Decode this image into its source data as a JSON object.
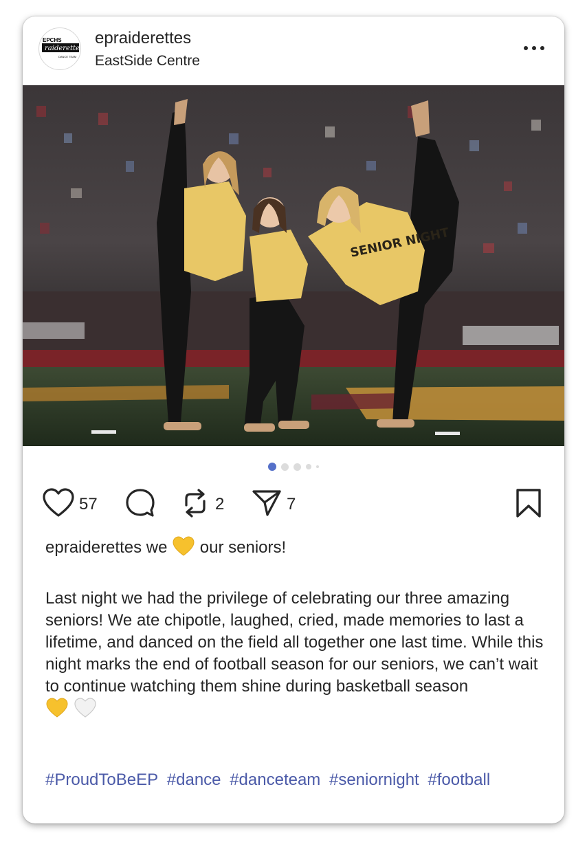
{
  "post": {
    "username": "epraiderettes",
    "location": "EastSide Centre",
    "avatar_text": {
      "top": "EPCHS",
      "middle": "raiderettes",
      "bottom": "DANCE TEAM"
    },
    "photo_shirt_text": "SENIOR NIGHT"
  },
  "carousel": {
    "count": 5,
    "active_index": 0
  },
  "actions": {
    "like_count": "57",
    "repost_count": "2",
    "share_count": "7"
  },
  "caption": {
    "username": "epraiderettes",
    "before_emoji": "we",
    "after_emoji": "our seniors!",
    "body": "Last night we had the privilege of celebrating our three amazing seniors! We ate chipotle, laughed, cried, made memories to last a lifetime, and danced on the field all together one last time. While this night marks the end of football season for our seniors, we can’t wait to continue watching them shine during basketball season",
    "hashtags": [
      "#ProudToBeEP",
      "#dance",
      "#danceteam",
      "#seniornight",
      "#football"
    ]
  },
  "colors": {
    "hashtag": "#4b5aa8",
    "dot_active": "#5570c9",
    "yellow_heart": "#f6c12d",
    "white_heart": "#f2f2f2"
  }
}
